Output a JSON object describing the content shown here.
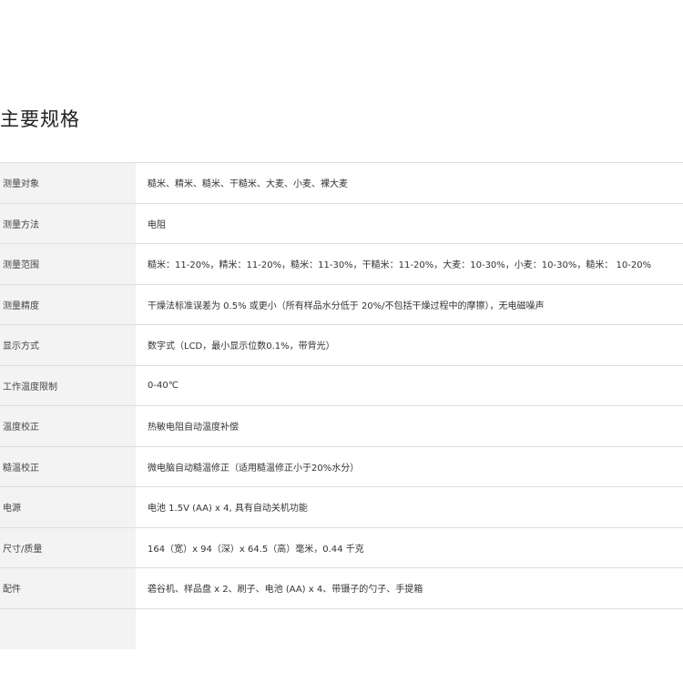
{
  "section": {
    "title": "主要规格"
  },
  "specs": [
    {
      "label": "测量对象",
      "value": "糙米、精米、糙米、干糙米、大麦、小麦、裸大麦"
    },
    {
      "label": "测量方法",
      "value": "电阻"
    },
    {
      "label": "测量范围",
      "value": "糙米：11-20%，精米：11-20%，糙米：11-30%，干糙米：11-20%，大麦：10-30%，小麦：10-30%，糙米： 10-20%"
    },
    {
      "label": "测量精度",
      "value": "干燥法标准误差为 0.5% 或更小（所有样品水分低于 20%/不包括干燥过程中的摩擦），无电磁噪声"
    },
    {
      "label": "显示方式",
      "value": "数字式（LCD，最小显示位数0.1%，带背光）"
    },
    {
      "label": "工作温度限制",
      "value": "0-40℃"
    },
    {
      "label": "温度校正",
      "value": "热敏电阻自动温度补偿"
    },
    {
      "label": "糙温校正",
      "value": "微电脑自动糙温修正（适用糙温修正小于20%水分）"
    },
    {
      "label": "电源",
      "value": "电池 1.5V (AA) x 4, 具有自动关机功能"
    },
    {
      "label": "尺寸/质量",
      "value": "164（宽）x 94（深）x 64.5（高）毫米，0.44 千克"
    },
    {
      "label": "配件",
      "value": "砻谷机、样品盘 x 2、刷子、电池 (AA) x 4、带镊子的勺子、手提箱"
    }
  ]
}
